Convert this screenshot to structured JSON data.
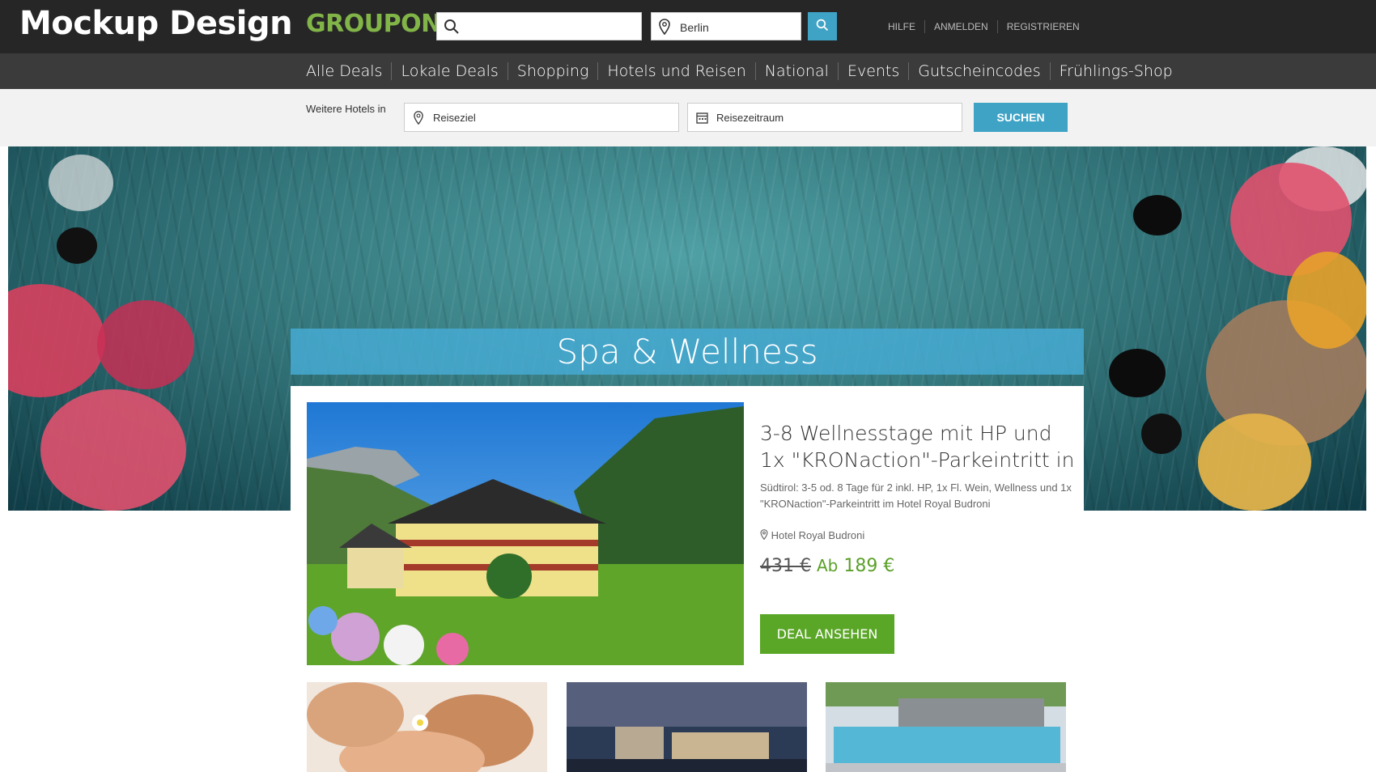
{
  "brand": {
    "overlay_text": "Mockup Design",
    "logo": "GROUPON",
    "accent": "#82b548"
  },
  "header": {
    "search_value": "",
    "location_value": "Berlin",
    "search_button_icon": "search-icon",
    "links": [
      "HILFE",
      "ANMELDEN",
      "REGISTRIEREN"
    ]
  },
  "nav": [
    "Alle Deals",
    "Lokale Deals",
    "Shopping",
    "Hotels und Reisen",
    "National",
    "Events",
    "Gutscheincodes",
    "Frühlings-Shop"
  ],
  "hotel_search": {
    "label": "Weitere Hotels in",
    "destination_placeholder": "Reiseziel",
    "date_placeholder": "Reisezeitraum",
    "button": "SUCHEN",
    "button_color": "#3fa3c5"
  },
  "hero": {
    "title": "Spa & Wellness"
  },
  "deal": {
    "title": "3-8 Wellnesstage mit HP und 1x \"KRONaction\"-Parkeintritt in",
    "description": "Südtirol: 3-5 od. 8 Tage für 2 inkl. HP, 1x Fl. Wein, Wellness und 1x \"KRONaction\"-Parkeintritt im Hotel Royal Budroni",
    "location": "Hotel Royal Budroni",
    "old_price": "431 €",
    "price_prefix": "Ab",
    "price": "189 €",
    "button": "DEAL ANSEHEN",
    "price_color": "#5ba02a"
  },
  "thumbnails": [
    "massage-photo",
    "lakeside-hotel-photo",
    "thermal-pool-photo"
  ]
}
